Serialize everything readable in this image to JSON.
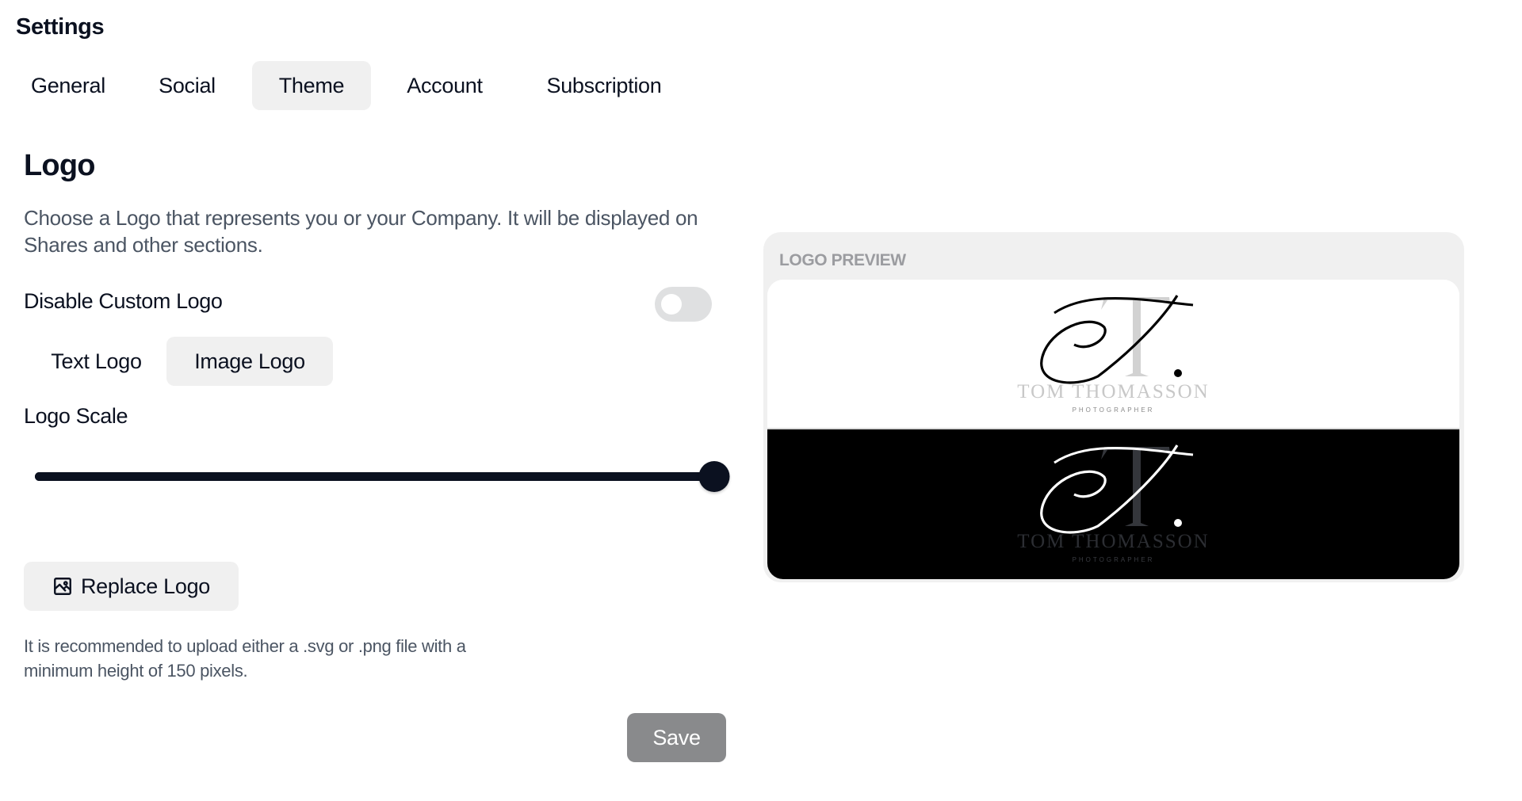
{
  "page": {
    "title": "Settings"
  },
  "tabs": [
    {
      "label": "General",
      "active": false
    },
    {
      "label": "Social",
      "active": false
    },
    {
      "label": "Theme",
      "active": true
    },
    {
      "label": "Account",
      "active": false
    },
    {
      "label": "Subscription",
      "active": false
    }
  ],
  "logo_section": {
    "title": "Logo",
    "description": "Choose a Logo that represents you or your Company. It will be displayed on Shares and other sections.",
    "disable_custom_logo": {
      "label": "Disable Custom Logo",
      "enabled": false
    },
    "logo_type": {
      "options": [
        "Text Logo",
        "Image Logo"
      ],
      "selected": "Image Logo"
    },
    "logo_scale": {
      "label": "Logo Scale",
      "value_fraction": 1.0
    },
    "replace_button": {
      "label": "Replace Logo",
      "icon": "image-icon"
    },
    "hint": "It is recommended to upload either a .svg or .png file with a minimum height of 150 pixels.",
    "save_button": {
      "label": "Save",
      "disabled": true
    }
  },
  "preview": {
    "label": "LOGO PREVIEW",
    "logo_name": "TOM THOMASSON",
    "logo_subtitle": "PHOTOGRAPHER",
    "variants": [
      "light",
      "dark"
    ]
  },
  "colors": {
    "text_primary": "#0b1120",
    "text_secondary": "#4b5563",
    "tab_active_bg": "#f0f0f0",
    "save_disabled_bg": "#898a8c",
    "toggle_off_bg": "#dfe0e1",
    "preview_label": "#9b9ca0"
  }
}
